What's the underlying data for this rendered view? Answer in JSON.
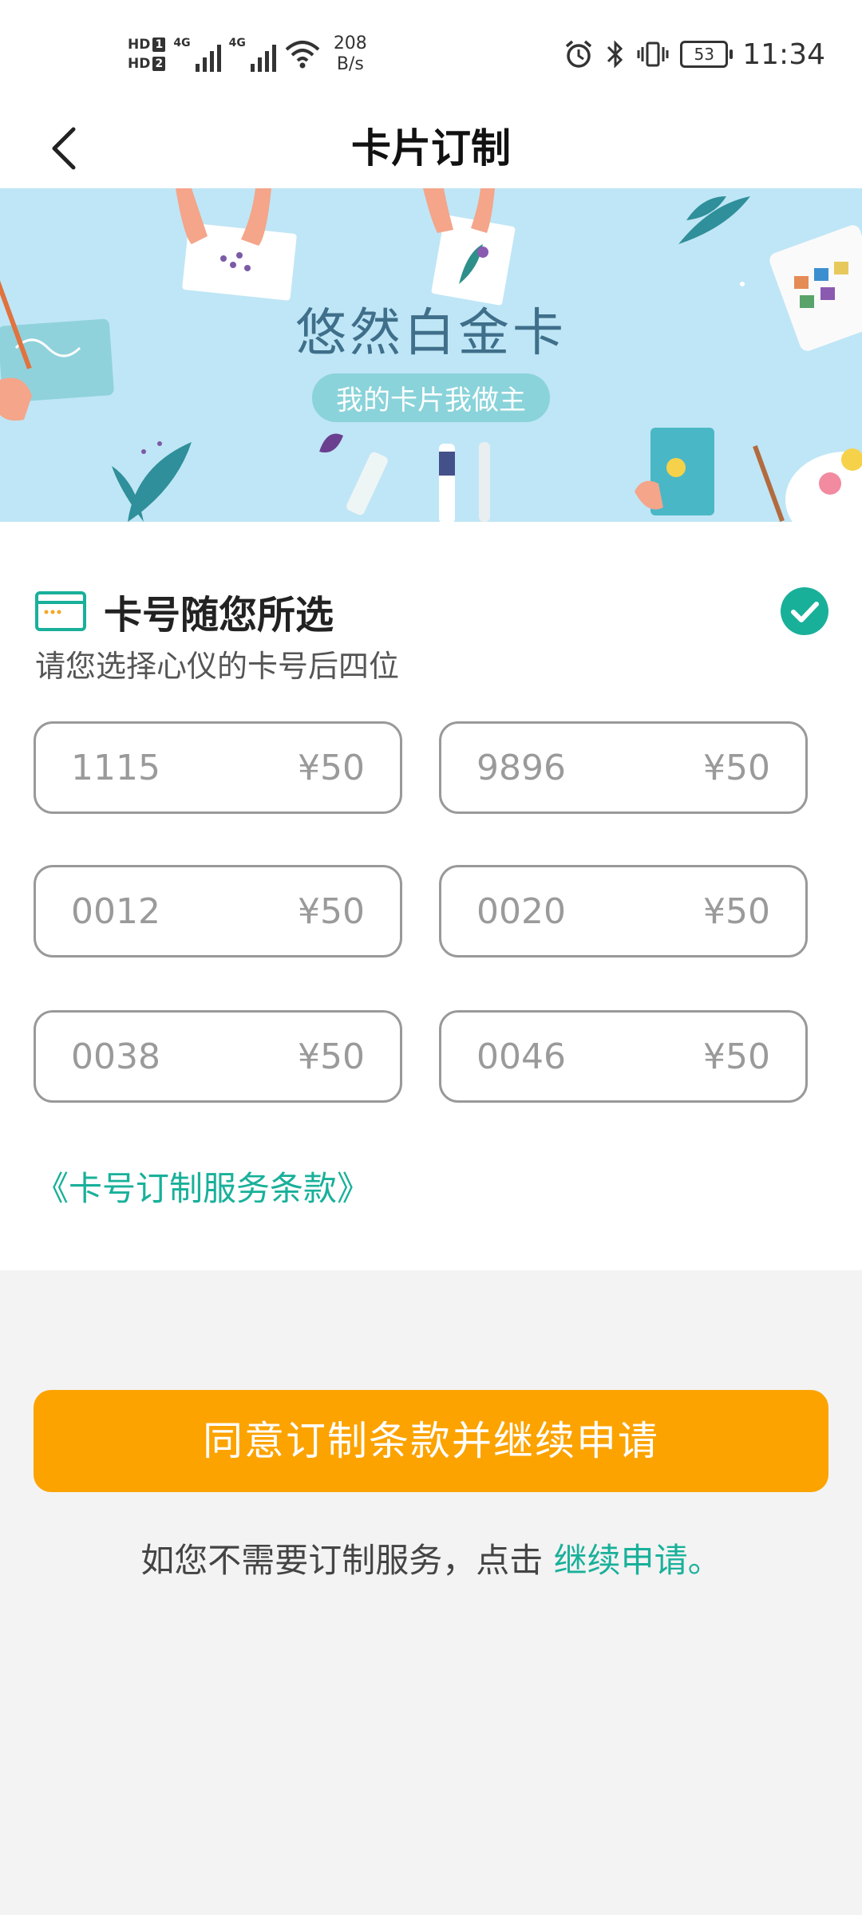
{
  "status_bar": {
    "hd1": "HD",
    "hd1_sim": "1",
    "hd2": "HD",
    "hd2_sim": "2",
    "net1": "4G",
    "net2": "4G",
    "net_speed_value": "208",
    "net_speed_unit": "B/s",
    "battery": "53",
    "time": "11:34"
  },
  "header": {
    "title": "卡片订制"
  },
  "banner": {
    "title": "悠然白金卡",
    "subtitle": "我的卡片我做主"
  },
  "card_number": {
    "title": "卡号随您所选",
    "subtitle": "请您选择心仪的卡号后四位",
    "options": [
      {
        "number": "1115",
        "price": "¥50"
      },
      {
        "number": "9896",
        "price": "¥50"
      },
      {
        "number": "0012",
        "price": "¥50"
      },
      {
        "number": "0020",
        "price": "¥50"
      },
      {
        "number": "0038",
        "price": "¥50"
      },
      {
        "number": "0046",
        "price": "¥50"
      }
    ],
    "terms_link": "《卡号订制服务条款》"
  },
  "actions": {
    "agree_button": "同意订制条款并继续申请",
    "skip_text": "如您不需要订制服务，点击",
    "skip_link": "继续申请。"
  },
  "colors": {
    "accent": "#19b09a",
    "cta": "#fca300",
    "banner_bg": "#bfe6f6"
  }
}
